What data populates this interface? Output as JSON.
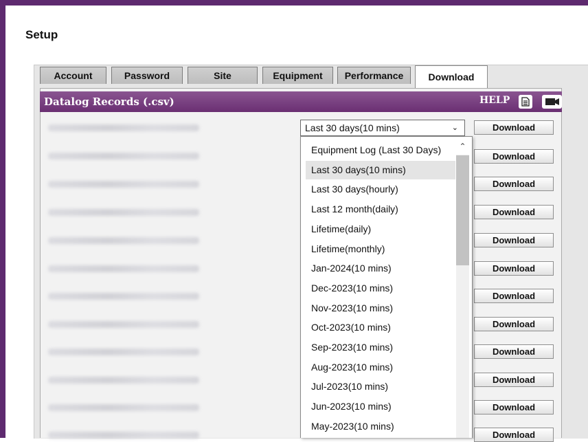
{
  "page": {
    "title": "Setup"
  },
  "tabs": [
    {
      "label": "Account",
      "active": false
    },
    {
      "label": "Password",
      "active": false
    },
    {
      "label": "Site",
      "active": false
    },
    {
      "label": "Equipment",
      "active": false
    },
    {
      "label": "Performance",
      "active": false
    },
    {
      "label": "Download",
      "active": true
    }
  ],
  "panel": {
    "title": "Datalog Records (.csv)",
    "help_label": "HELP",
    "icons": [
      "document-icon",
      "video-camera-icon"
    ]
  },
  "select": {
    "value": "Last 30 days(10 mins)",
    "options": [
      "Equipment Log (Last 30 Days)",
      "Last 30 days(10 mins)",
      "Last 30 days(hourly)",
      "Last 12 month(daily)",
      "Lifetime(daily)",
      "Lifetime(monthly)",
      "Jan-2024(10 mins)",
      "Dec-2023(10 mins)",
      "Nov-2023(10 mins)",
      "Oct-2023(10 mins)",
      "Sep-2023(10 mins)",
      "Aug-2023(10 mins)",
      "Jul-2023(10 mins)",
      "Jun-2023(10 mins)",
      "May-2023(10 mins)"
    ],
    "selected_index": 1
  },
  "rows": {
    "download_label": "Download",
    "count": 12
  },
  "colors": {
    "frame": "#5e2a6f",
    "header_top": "#8a5591",
    "header_bottom": "#6a2f72"
  }
}
